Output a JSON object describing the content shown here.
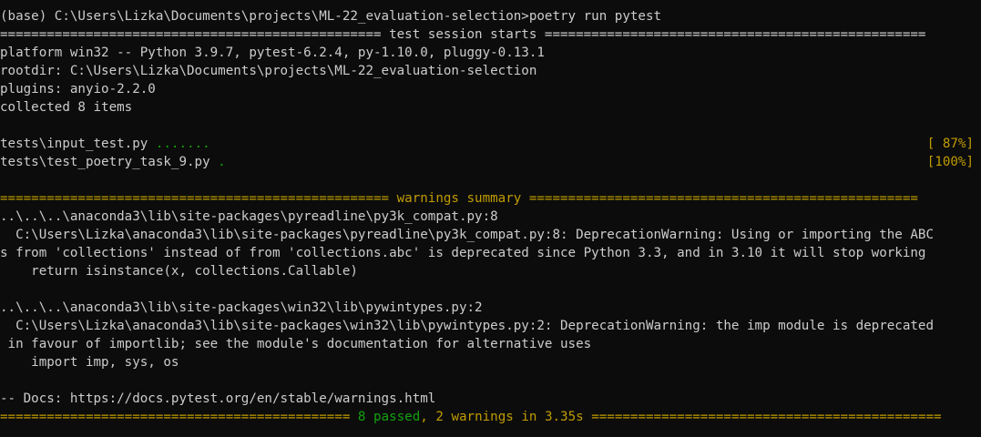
{
  "colors": {
    "background": "#0c0c0c",
    "text": "#cccccc",
    "green": "#13a10e",
    "yellow": "#c19c00"
  },
  "prompt": {
    "path": "(base) C:\\Users\\Lizka\\Documents\\projects\\ML-22_evaluation-selection>",
    "command": "poetry run pytest"
  },
  "session_header": {
    "left": "================================================= ",
    "title": "test session starts",
    "right": " ================================================="
  },
  "info_lines": [
    "platform win32 -- Python 3.9.7, pytest-6.2.4, py-1.10.0, pluggy-0.13.1",
    "rootdir: C:\\Users\\Lizka\\Documents\\projects\\ML-22_evaluation-selection",
    "plugins: anyio-2.2.0",
    "collected 8 items"
  ],
  "test_files": [
    {
      "name": "tests\\input_test.py ",
      "dots": ".......",
      "percent": "[ 87%]"
    },
    {
      "name": "tests\\test_poetry_task_9.py ",
      "dots": ".",
      "percent": "[100%]"
    }
  ],
  "warnings_header": {
    "left": "================================================== ",
    "title": "warnings summary",
    "right": " =================================================="
  },
  "warnings": [
    {
      "location": "..\\..\\..\\anaconda3\\lib\\site-packages\\pyreadline\\py3k_compat.py:8",
      "message_line1": "  C:\\Users\\Lizka\\anaconda3\\lib\\site-packages\\pyreadline\\py3k_compat.py:8: DeprecationWarning: Using or importing the ABC",
      "message_line2": "s from 'collections' instead of from 'collections.abc' is deprecated since Python 3.3, and in 3.10 it will stop working",
      "code": "    return isinstance(x, collections.Callable)"
    },
    {
      "location": "..\\..\\..\\anaconda3\\lib\\site-packages\\win32\\lib\\pywintypes.py:2",
      "message_line1": "  C:\\Users\\Lizka\\anaconda3\\lib\\site-packages\\win32\\lib\\pywintypes.py:2: DeprecationWarning: the imp module is deprecated",
      "message_line2": " in favour of importlib; see the module's documentation for alternative uses",
      "code": "    import imp, sys, os"
    }
  ],
  "docs_line": "-- Docs: https://docs.pytest.org/en/stable/warnings.html",
  "summary": {
    "left": "============================================= ",
    "passed": "8 passed",
    "comma": ", ",
    "warnings": "2 warnings",
    "time": " in 3.35s",
    "right": " ============================================="
  }
}
